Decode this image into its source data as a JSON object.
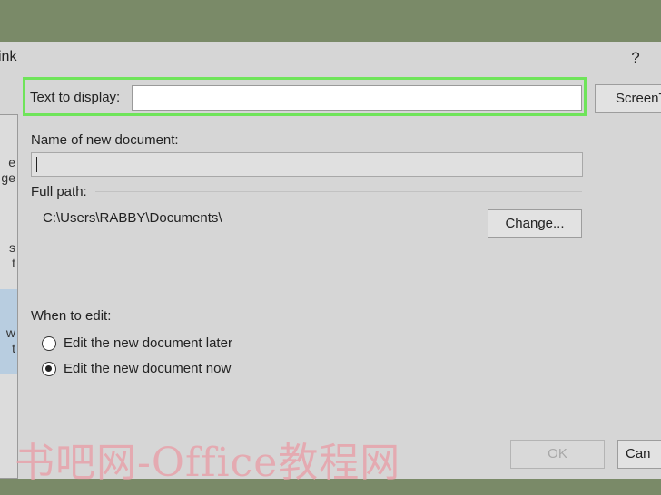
{
  "dialog": {
    "title": "ink",
    "help": "?"
  },
  "sidebar": {
    "items": [
      {
        "line1": "e",
        "line2": "ge"
      },
      {
        "line1": "s",
        "line2": "t"
      },
      {
        "line1": "w",
        "line2": "t"
      }
    ]
  },
  "display": {
    "label": "Text to display:",
    "value": "",
    "screentip_label": "ScreenT"
  },
  "new_doc": {
    "label": "Name of new document:",
    "value": ""
  },
  "path": {
    "label": "Full path:",
    "value": "C:\\Users\\RABBY\\Documents\\",
    "change_label": "Change..."
  },
  "when_to_edit": {
    "label": "When to edit:",
    "options": [
      {
        "label": "Edit the new document later",
        "selected": false
      },
      {
        "label": "Edit the new document now",
        "selected": true
      }
    ]
  },
  "buttons": {
    "ok": "OK",
    "cancel": "Can"
  },
  "watermark": "书吧网-Office教程网"
}
